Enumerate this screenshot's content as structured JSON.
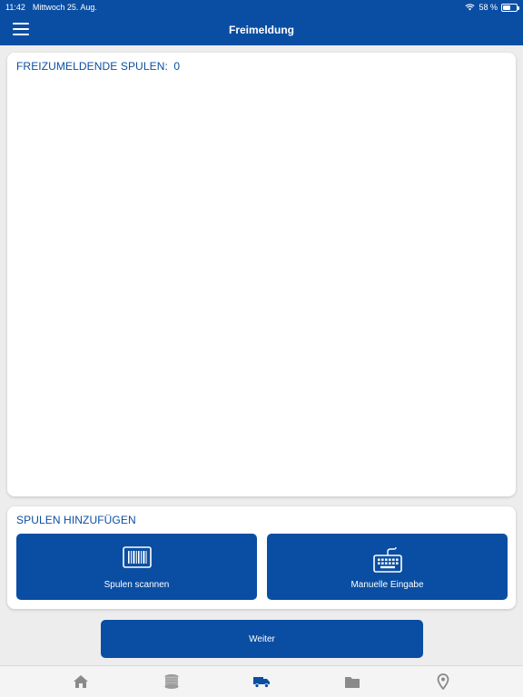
{
  "status_bar": {
    "time": "11:42",
    "date": "Mittwoch 25. Aug.",
    "battery": "58 %",
    "battery_level": 0.58
  },
  "header": {
    "title": "Freimeldung"
  },
  "list_card": {
    "heading": "FREIZUMELDENDE SPULEN:",
    "count": "0"
  },
  "add_card": {
    "heading": "SPULEN HINZUFÜGEN",
    "scan_label": "Spulen scannen",
    "manual_label": "Manuelle Eingabe"
  },
  "next_button": {
    "label": "Weiter"
  },
  "tabs": [
    {
      "icon": "home-icon"
    },
    {
      "icon": "spool-icon"
    },
    {
      "icon": "truck-icon"
    },
    {
      "icon": "folder-icon"
    },
    {
      "icon": "location-pin-icon"
    }
  ],
  "colors": {
    "primary": "#0a4ea3",
    "active_tab": "#0a4ea3",
    "inactive_tab": "#8a8a8a"
  }
}
